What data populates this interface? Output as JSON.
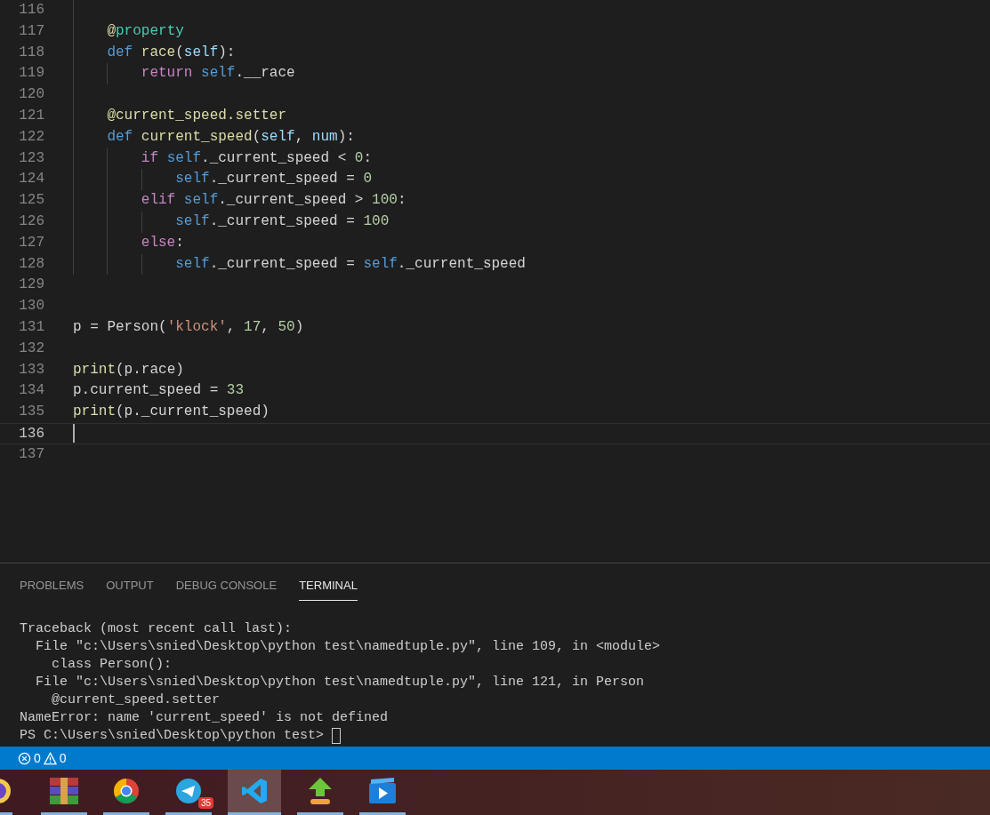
{
  "editor": {
    "lines": [
      {
        "number": "116",
        "current": false
      },
      {
        "number": "117",
        "current": false,
        "tokens": [
          {
            "text": "    @",
            "kind": "function"
          },
          {
            "text": "property",
            "kind": "class"
          }
        ]
      },
      {
        "number": "118",
        "current": false,
        "tokens": [
          {
            "text": "    def ",
            "kind": "keyword"
          },
          {
            "text": "race",
            "kind": "function"
          },
          {
            "text": "(",
            "kind": "plain"
          },
          {
            "text": "self",
            "kind": "param"
          },
          {
            "text": "):",
            "kind": "plain"
          }
        ]
      },
      {
        "number": "119",
        "current": false,
        "tokens": [
          {
            "text": "        return ",
            "kind": "control"
          },
          {
            "text": "self",
            "kind": "keyword"
          },
          {
            "text": ".__race",
            "kind": "plain"
          }
        ]
      },
      {
        "number": "120",
        "current": false
      },
      {
        "number": "121",
        "current": false,
        "tokens": [
          {
            "text": "    @current_speed.setter",
            "kind": "function"
          }
        ]
      },
      {
        "number": "122",
        "current": false,
        "tokens": [
          {
            "text": "    def ",
            "kind": "keyword"
          },
          {
            "text": "current_speed",
            "kind": "function"
          },
          {
            "text": "(",
            "kind": "plain"
          },
          {
            "text": "self",
            "kind": "param"
          },
          {
            "text": ", ",
            "kind": "plain"
          },
          {
            "text": "num",
            "kind": "param"
          },
          {
            "text": "):",
            "kind": "plain"
          }
        ]
      },
      {
        "number": "123",
        "current": false,
        "tokens": [
          {
            "text": "        if ",
            "kind": "control"
          },
          {
            "text": "self",
            "kind": "keyword"
          },
          {
            "text": "._current_speed < ",
            "kind": "plain"
          },
          {
            "text": "0",
            "kind": "number"
          },
          {
            "text": ":",
            "kind": "plain"
          }
        ]
      },
      {
        "number": "124",
        "current": false,
        "tokens": [
          {
            "text": "            self",
            "kind": "keyword"
          },
          {
            "text": "._current_speed = ",
            "kind": "plain"
          },
          {
            "text": "0",
            "kind": "number"
          }
        ]
      },
      {
        "number": "125",
        "current": false,
        "tokens": [
          {
            "text": "        elif ",
            "kind": "control"
          },
          {
            "text": "self",
            "kind": "keyword"
          },
          {
            "text": "._current_speed > ",
            "kind": "plain"
          },
          {
            "text": "100",
            "kind": "number"
          },
          {
            "text": ":",
            "kind": "plain"
          }
        ]
      },
      {
        "number": "126",
        "current": false,
        "tokens": [
          {
            "text": "            self",
            "kind": "keyword"
          },
          {
            "text": "._current_speed = ",
            "kind": "plain"
          },
          {
            "text": "100",
            "kind": "number"
          }
        ]
      },
      {
        "number": "127",
        "current": false,
        "tokens": [
          {
            "text": "        else",
            "kind": "control"
          },
          {
            "text": ":",
            "kind": "plain"
          }
        ]
      },
      {
        "number": "128",
        "current": false,
        "tokens": [
          {
            "text": "            self",
            "kind": "keyword"
          },
          {
            "text": "._current_speed = ",
            "kind": "plain"
          },
          {
            "text": "self",
            "kind": "keyword"
          },
          {
            "text": "._current_speed",
            "kind": "plain"
          }
        ]
      },
      {
        "number": "129",
        "current": false
      },
      {
        "number": "130",
        "current": false
      },
      {
        "number": "131",
        "current": false,
        "tokens": [
          {
            "text": "p = Person(",
            "kind": "plain"
          },
          {
            "text": "'klock'",
            "kind": "string"
          },
          {
            "text": ", ",
            "kind": "plain"
          },
          {
            "text": "17",
            "kind": "number"
          },
          {
            "text": ", ",
            "kind": "plain"
          },
          {
            "text": "50",
            "kind": "number"
          },
          {
            "text": ")",
            "kind": "plain"
          }
        ]
      },
      {
        "number": "132",
        "current": false
      },
      {
        "number": "133",
        "current": false,
        "tokens": [
          {
            "text": "print",
            "kind": "function"
          },
          {
            "text": "(p.race)",
            "kind": "plain"
          }
        ]
      },
      {
        "number": "134",
        "current": false,
        "tokens": [
          {
            "text": "p.current_speed = ",
            "kind": "plain"
          },
          {
            "text": "33",
            "kind": "number"
          }
        ]
      },
      {
        "number": "135",
        "current": false,
        "tokens": [
          {
            "text": "print",
            "kind": "function"
          },
          {
            "text": "(p._current_speed)",
            "kind": "plain"
          }
        ]
      },
      {
        "number": "136",
        "current": true
      },
      {
        "number": "137",
        "current": false
      }
    ]
  },
  "panel": {
    "tabs": [
      {
        "label": "PROBLEMS",
        "selected": false
      },
      {
        "label": "OUTPUT",
        "selected": false
      },
      {
        "label": "DEBUG CONSOLE",
        "selected": false
      },
      {
        "label": "TERMINAL",
        "selected": true
      }
    ],
    "terminal": [
      "Traceback (most recent call last):",
      "  File \"c:\\Users\\snied\\Desktop\\python test\\namedtuple.py\", line 109, in <module>",
      "    class Person():",
      "  File \"c:\\Users\\snied\\Desktop\\python test\\namedtuple.py\", line 121, in Person",
      "    @current_speed.setter",
      "NameError: name 'current_speed' is not defined"
    ],
    "prompt": "PS C:\\Users\\snied\\Desktop\\python test> "
  },
  "status_bar": {
    "errors": "0",
    "warnings": "0"
  },
  "taskbar": [
    {
      "kind": "partial",
      "selected": false
    },
    {
      "kind": "archive",
      "selected": false
    },
    {
      "kind": "browser",
      "selected": false
    },
    {
      "kind": "messenger",
      "selected": false,
      "badge": "35"
    },
    {
      "kind": "editor",
      "selected": true
    },
    {
      "kind": "upload",
      "selected": false
    },
    {
      "kind": "video",
      "selected": false
    }
  ]
}
